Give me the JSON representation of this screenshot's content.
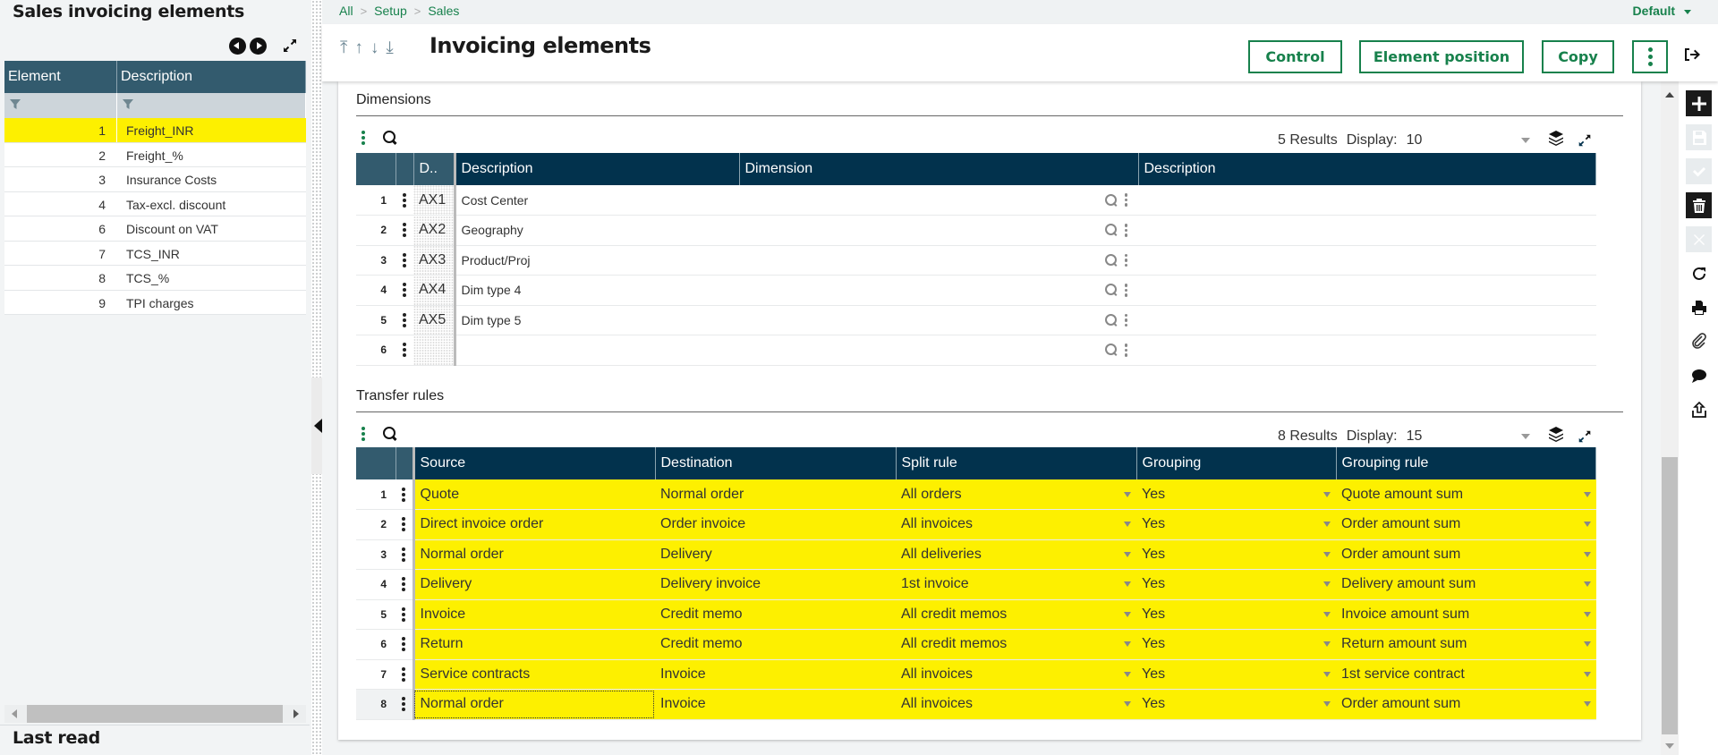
{
  "left_panel": {
    "title": "Sales invoicing elements",
    "columns": [
      "Element",
      "Description"
    ],
    "rows": [
      {
        "element": "1",
        "description": "Freight_INR",
        "selected": true
      },
      {
        "element": "2",
        "description": "Freight_%",
        "selected": false
      },
      {
        "element": "3",
        "description": "Insurance Costs",
        "selected": false
      },
      {
        "element": "4",
        "description": "Tax-excl. discount",
        "selected": false
      },
      {
        "element": "6",
        "description": "Discount on VAT",
        "selected": false
      },
      {
        "element": "7",
        "description": "TCS_INR",
        "selected": false
      },
      {
        "element": "8",
        "description": "TCS_%",
        "selected": false
      },
      {
        "element": "9",
        "description": "TPI charges",
        "selected": false
      }
    ],
    "last_read_label": "Last read"
  },
  "breadcrumb": [
    "All",
    "Setup",
    "Sales"
  ],
  "profile_selector": "Default",
  "header": {
    "title": "Invoicing elements",
    "buttons": {
      "control": "Control",
      "element_position": "Element position",
      "copy": "Copy"
    }
  },
  "dimensions": {
    "section_title": "Dimensions",
    "results_text": "5 Results",
    "display_label": "Display:",
    "display_value": "10",
    "columns": [
      "D..",
      "Description",
      "Dimension",
      "Description"
    ],
    "rows": [
      {
        "num": "1",
        "code": "AX1",
        "description": "Cost Center",
        "dimension": "",
        "dim_description": ""
      },
      {
        "num": "2",
        "code": "AX2",
        "description": "Geography",
        "dimension": "",
        "dim_description": ""
      },
      {
        "num": "3",
        "code": "AX3",
        "description": "Product/Proj",
        "dimension": "",
        "dim_description": ""
      },
      {
        "num": "4",
        "code": "AX4",
        "description": "Dim type 4",
        "dimension": "",
        "dim_description": ""
      },
      {
        "num": "5",
        "code": "AX5",
        "description": "Dim type 5",
        "dimension": "",
        "dim_description": ""
      },
      {
        "num": "6",
        "code": "",
        "description": "",
        "dimension": "",
        "dim_description": ""
      }
    ]
  },
  "transfer_rules": {
    "section_title": "Transfer rules",
    "results_text": "8 Results",
    "display_label": "Display:",
    "display_value": "15",
    "columns": [
      "Source",
      "Destination",
      "Split rule",
      "Grouping",
      "Grouping rule"
    ],
    "rows": [
      {
        "num": "1",
        "source": "Quote",
        "destination": "Normal order",
        "split_rule": "All orders",
        "grouping": "Yes",
        "grouping_rule": "Quote amount sum"
      },
      {
        "num": "2",
        "source": "Direct invoice order",
        "destination": "Order invoice",
        "split_rule": "All invoices",
        "grouping": "Yes",
        "grouping_rule": "Order amount sum"
      },
      {
        "num": "3",
        "source": "Normal order",
        "destination": "Delivery",
        "split_rule": "All deliveries",
        "grouping": "Yes",
        "grouping_rule": "Order amount sum"
      },
      {
        "num": "4",
        "source": "Delivery",
        "destination": "Delivery invoice",
        "split_rule": "1st invoice",
        "grouping": "Yes",
        "grouping_rule": "Delivery amount sum"
      },
      {
        "num": "5",
        "source": "Invoice",
        "destination": "Credit memo",
        "split_rule": "All credit memos",
        "grouping": "Yes",
        "grouping_rule": "Invoice amount sum"
      },
      {
        "num": "6",
        "source": "Return",
        "destination": "Credit memo",
        "split_rule": "All credit memos",
        "grouping": "Yes",
        "grouping_rule": "Return amount sum"
      },
      {
        "num": "7",
        "source": "Service contracts",
        "destination": "Invoice",
        "split_rule": "All invoices",
        "grouping": "Yes",
        "grouping_rule": "1st service contract"
      },
      {
        "num": "8",
        "source": "Normal order",
        "destination": "Invoice",
        "split_rule": "All invoices",
        "grouping": "Yes",
        "grouping_rule": "Order amount sum"
      }
    ]
  },
  "colors": {
    "accent_green": "#17814c",
    "grid_header": "#02324d",
    "highlight_yellow": "#fdf000"
  }
}
